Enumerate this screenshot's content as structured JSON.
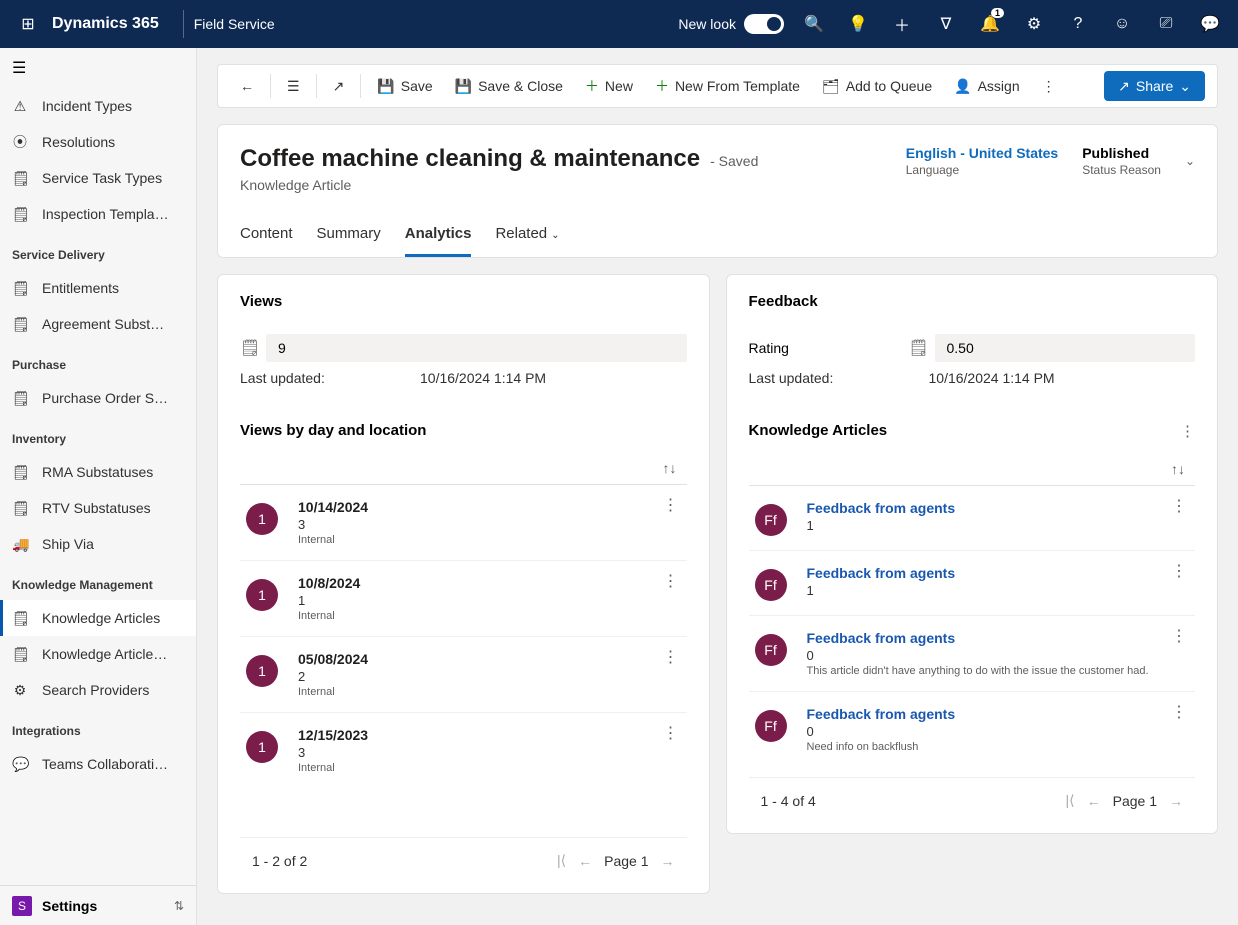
{
  "topnav": {
    "brand": "Dynamics 365",
    "app": "Field Service",
    "new_look": "New look",
    "notifications_badge": "1"
  },
  "sidebar": {
    "groups": [
      {
        "items": [
          {
            "icon": "⚠",
            "label": "Incident Types"
          },
          {
            "icon": "⦿",
            "label": "Resolutions"
          },
          {
            "icon": "🗒",
            "label": "Service Task Types"
          },
          {
            "icon": "🗒",
            "label": "Inspection Templa…"
          }
        ]
      },
      {
        "title": "Service Delivery",
        "items": [
          {
            "icon": "🗒",
            "label": "Entitlements"
          },
          {
            "icon": "🗒",
            "label": "Agreement Subst…"
          }
        ]
      },
      {
        "title": "Purchase",
        "items": [
          {
            "icon": "🗒",
            "label": "Purchase Order S…"
          }
        ]
      },
      {
        "title": "Inventory",
        "items": [
          {
            "icon": "🗒",
            "label": "RMA Substatuses"
          },
          {
            "icon": "🗒",
            "label": "RTV Substatuses"
          },
          {
            "icon": "🚚",
            "label": "Ship Via"
          }
        ]
      },
      {
        "title": "Knowledge Management",
        "items": [
          {
            "icon": "🗒",
            "label": "Knowledge Articles",
            "selected": true
          },
          {
            "icon": "🗒",
            "label": "Knowledge Article…"
          },
          {
            "icon": "⚙",
            "label": "Search Providers"
          }
        ]
      },
      {
        "title": "Integrations",
        "items": [
          {
            "icon": "💬",
            "label": "Teams Collaborati…"
          }
        ]
      }
    ],
    "footer_label": "Settings"
  },
  "cmdbar": {
    "save": "Save",
    "save_close": "Save & Close",
    "new": "New",
    "new_template": "New From Template",
    "add_queue": "Add to Queue",
    "assign": "Assign",
    "share": "Share"
  },
  "record": {
    "title": "Coffee machine cleaning & maintenance",
    "saved": "- Saved",
    "subtitle": "Knowledge Article",
    "language_val": "English - United States",
    "language_lbl": "Language",
    "status_val": "Published",
    "status_lbl": "Status Reason"
  },
  "tabs": {
    "content": "Content",
    "summary": "Summary",
    "analytics": "Analytics",
    "related": "Related"
  },
  "views_panel": {
    "title": "Views",
    "count": "9",
    "updated_lbl": "Last updated:",
    "updated_val": "10/16/2024 1:14 PM",
    "section": "Views by day and location",
    "items": [
      {
        "badge": "1",
        "date": "10/14/2024",
        "num": "3",
        "int": "Internal"
      },
      {
        "badge": "1",
        "date": "10/8/2024",
        "num": "1",
        "int": "Internal"
      },
      {
        "badge": "1",
        "date": "05/08/2024",
        "num": "2",
        "int": "Internal"
      },
      {
        "badge": "1",
        "date": "12/15/2023",
        "num": "3",
        "int": "Internal"
      }
    ],
    "pager_range": "1 - 2 of 2",
    "pager_page": "Page 1"
  },
  "feedback_panel": {
    "title": "Feedback",
    "rating_lbl": "Rating",
    "rating_val": "0.50",
    "updated_lbl": "Last updated:",
    "updated_val": "10/16/2024 1:14 PM",
    "section": "Knowledge Articles",
    "items": [
      {
        "badge": "Ff",
        "title": "Feedback from agents",
        "num": "1",
        "comment": ""
      },
      {
        "badge": "Ff",
        "title": "Feedback from agents",
        "num": "1",
        "comment": ""
      },
      {
        "badge": "Ff",
        "title": "Feedback from agents",
        "num": "0",
        "comment": "This article didn't have anything to do with the issue the customer had."
      },
      {
        "badge": "Ff",
        "title": "Feedback from agents",
        "num": "0",
        "comment": "Need info on backflush"
      }
    ],
    "pager_range": "1 - 4 of 4",
    "pager_page": "Page 1"
  }
}
